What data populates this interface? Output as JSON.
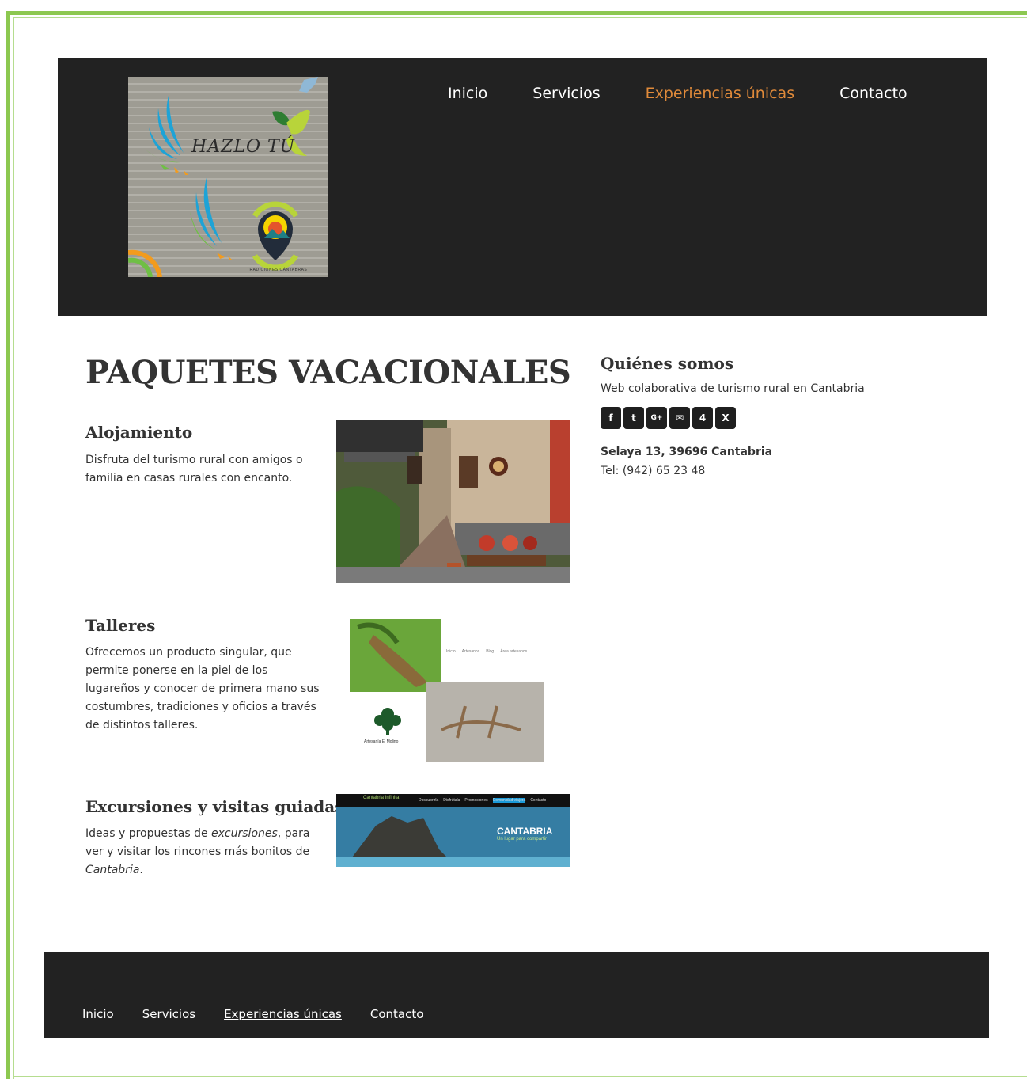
{
  "logo": {
    "text": "HAZLO TÚ",
    "caption": "TRADICIONES CÁNTABRAS"
  },
  "nav": {
    "items": [
      {
        "label": "Inicio",
        "active": false
      },
      {
        "label": "Servicios",
        "active": false
      },
      {
        "label": "Experiencias únicas",
        "active": true
      },
      {
        "label": "Contacto",
        "active": false
      }
    ]
  },
  "main": {
    "title": "PAQUETES VACACIONALES",
    "sections": [
      {
        "title": "Alojamiento",
        "text": "Disfruta del turismo rural con amigos o familia en casas rurales con encanto."
      },
      {
        "title": "Talleres",
        "text": "Ofrecemos un producto singular, que permite ponerse en la piel de los lugareños y conocer de primera mano sus costumbres, tradiciones y oficios a través de distintos talleres."
      },
      {
        "title": "Excursiones y visitas guiadas",
        "text_parts": [
          "Ideas y propuestas de ",
          "excursiones",
          ", para ver y visitar los rincones más bonitos de ",
          "Cantabria",
          "."
        ]
      }
    ],
    "workshop_image": {
      "menu_items": [
        "Inicio",
        "Artesanos",
        "Blog",
        "Área artesanos"
      ],
      "caption": "Artesanía El Molino"
    },
    "excursion_image": {
      "brand": "Cantabria Infinita",
      "menu_items": [
        "Descubrirla",
        "Disfrútala",
        "Promociones",
        "Comunidad viajera",
        "Contacto"
      ],
      "headline": "CANTABRIA",
      "tagline": "Un lugar para compartir"
    }
  },
  "sidebar": {
    "title": "Quiénes somos",
    "description": "Web colaborativa de turismo rural en Cantabria",
    "social_icons": [
      {
        "name": "facebook-icon",
        "glyph": "f"
      },
      {
        "name": "twitter-icon",
        "glyph": "t"
      },
      {
        "name": "google-plus-icon",
        "glyph": "G+"
      },
      {
        "name": "email-icon",
        "glyph": "✉"
      },
      {
        "name": "foursquare-icon",
        "glyph": "4"
      },
      {
        "name": "xing-icon",
        "glyph": "X"
      }
    ],
    "address": "Selaya 13, 39696 Cantabria",
    "phone": "Tel: (942) 65 23 48"
  },
  "footer": {
    "items": [
      {
        "label": "Inicio",
        "active": false
      },
      {
        "label": "Servicios",
        "active": false
      },
      {
        "label": "Experiencias únicas",
        "active": true
      },
      {
        "label": "Contacto",
        "active": false
      }
    ]
  },
  "colors": {
    "frame": "#8cc850",
    "header_bg": "#222222",
    "nav_active": "#e08a3a",
    "text": "#333333"
  }
}
